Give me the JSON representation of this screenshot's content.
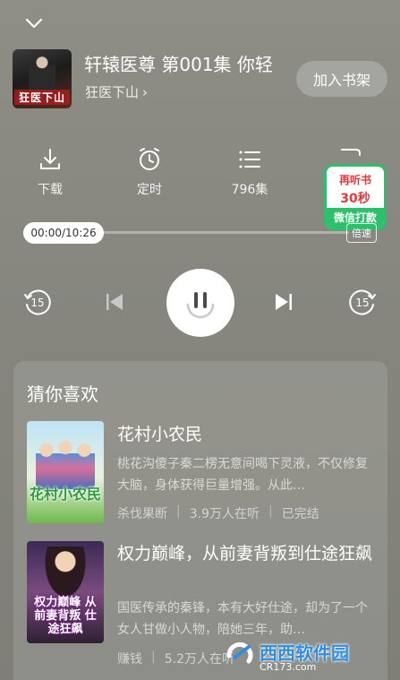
{
  "player": {
    "episode_title": "轩辕医尊 第001集 你轻",
    "album_name": "狂医下山",
    "album_chevron": "›",
    "cover_text": "狂医下山",
    "bookshelf_label": "加入书架",
    "functions": [
      {
        "label": "下载",
        "icon": "download-icon"
      },
      {
        "label": "定时",
        "icon": "alarm-icon"
      },
      {
        "label": "796集",
        "icon": "list-icon"
      },
      {
        "label": "…",
        "icon": "more-icon"
      }
    ],
    "promo": {
      "line1": "再听书",
      "line2": "30秒",
      "button": "微信打款"
    },
    "time_display": "00:00/10:26",
    "progress_fraction": 0.0,
    "speed_label": "倍速",
    "rewind_label": "15",
    "forward_label": "15"
  },
  "recommend": {
    "title": "猜你喜欢",
    "items": [
      {
        "name": "花村小农民",
        "desc": "桃花沟傻子秦二楞无意间喝下灵液，不仅修复大脑，身体获得巨量增强。从此…",
        "author": "杀伐果断",
        "listeners": "3.9万人在听",
        "status": "已完结",
        "cover_text": "花村小农民"
      },
      {
        "name": "权力巅峰，从前妻背叛到仕途狂飙",
        "desc": "国医传承的秦锋，本有大好仕途，却为了一个女人甘做小人物，陪她三年，助…",
        "author": "赚钱",
        "listeners": "5.2万人在听",
        "status": "",
        "cover_text": "权力巅峰 从前妻背叛 仕途狂飙"
      }
    ]
  },
  "watermark": {
    "text": "西西软件园",
    "sub": "CR173.com"
  },
  "colors": {
    "accent_green": "#2cc06a",
    "promo_red": "#e23a3a",
    "background": "#878780"
  }
}
